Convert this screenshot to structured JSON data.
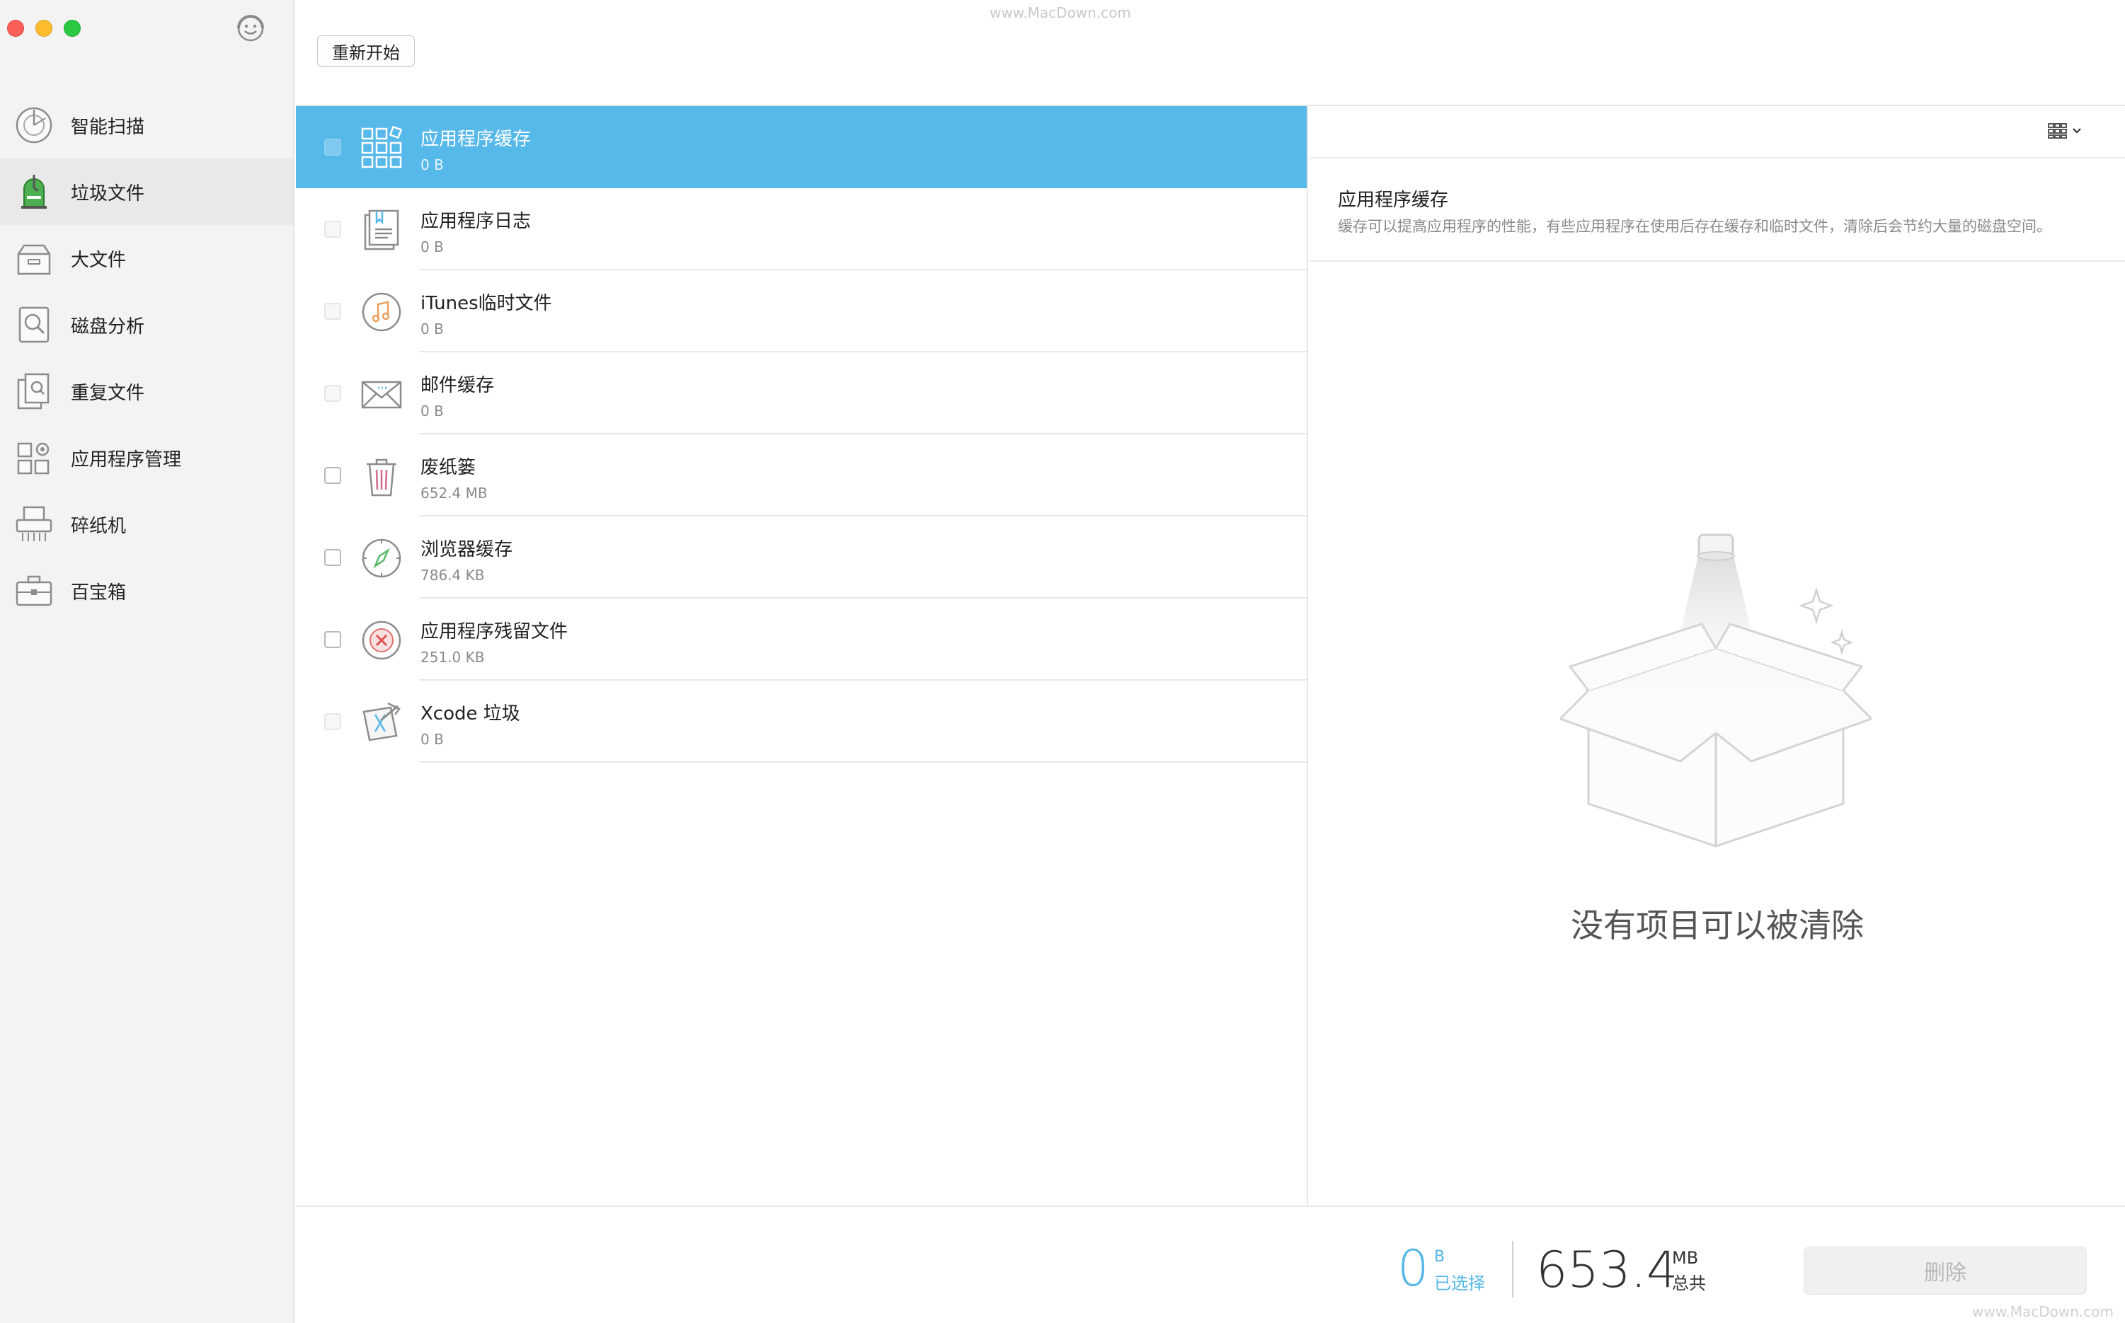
{
  "toolbar": {
    "restart_label": "重新开始",
    "watermark": "www.MacDown.com"
  },
  "sidebar": {
    "items": [
      {
        "label": "智能扫描",
        "icon": "smart-scan-icon",
        "active": false
      },
      {
        "label": "垃圾文件",
        "icon": "junk-vacuum-icon",
        "active": true
      },
      {
        "label": "大文件",
        "icon": "large-files-icon",
        "active": false
      },
      {
        "label": "磁盘分析",
        "icon": "disk-analysis-icon",
        "active": false
      },
      {
        "label": "重复文件",
        "icon": "duplicate-files-icon",
        "active": false
      },
      {
        "label": "应用程序管理",
        "icon": "app-manager-icon",
        "active": false
      },
      {
        "label": "碎纸机",
        "icon": "shredder-icon",
        "active": false
      },
      {
        "label": "百宝箱",
        "icon": "toolbox-icon",
        "active": false
      }
    ]
  },
  "list": {
    "rows": [
      {
        "name": "应用程序缓存",
        "size": "0 B",
        "icon": "app-cache-icon",
        "selected": true,
        "enabled": false
      },
      {
        "name": "应用程序日志",
        "size": "0 B",
        "icon": "app-log-icon",
        "selected": false,
        "enabled": false
      },
      {
        "name": "iTunes临时文件",
        "size": "0 B",
        "icon": "itunes-icon",
        "selected": false,
        "enabled": false
      },
      {
        "name": "邮件缓存",
        "size": "0 B",
        "icon": "mail-icon",
        "selected": false,
        "enabled": false
      },
      {
        "name": "废纸篓",
        "size": "652.4 MB",
        "icon": "trash-icon",
        "selected": false,
        "enabled": true
      },
      {
        "name": "浏览器缓存",
        "size": "786.4 KB",
        "icon": "browser-compass-icon",
        "selected": false,
        "enabled": true
      },
      {
        "name": "应用程序残留文件",
        "size": "251.0 KB",
        "icon": "app-leftover-icon",
        "selected": false,
        "enabled": true
      },
      {
        "name": "Xcode 垃圾",
        "size": "0 B",
        "icon": "xcode-icon",
        "selected": false,
        "enabled": false
      }
    ]
  },
  "detail": {
    "title": "应用程序缓存",
    "description": "缓存可以提高应用程序的性能，有些应用程序在使用后存在缓存和临时文件，清除后会节约大量的磁盘空间。",
    "empty_text": "没有项目可以被清除"
  },
  "footer": {
    "selected_value": "0",
    "selected_unit": "B",
    "selected_label": "已选择",
    "total_value": "653.4",
    "total_unit": "MB",
    "total_label": "总共",
    "delete_label": "删除",
    "watermark": "www.MacDown.com"
  },
  "colors": {
    "accent": "#57b8ea",
    "selected_text": "#54b7e8"
  }
}
